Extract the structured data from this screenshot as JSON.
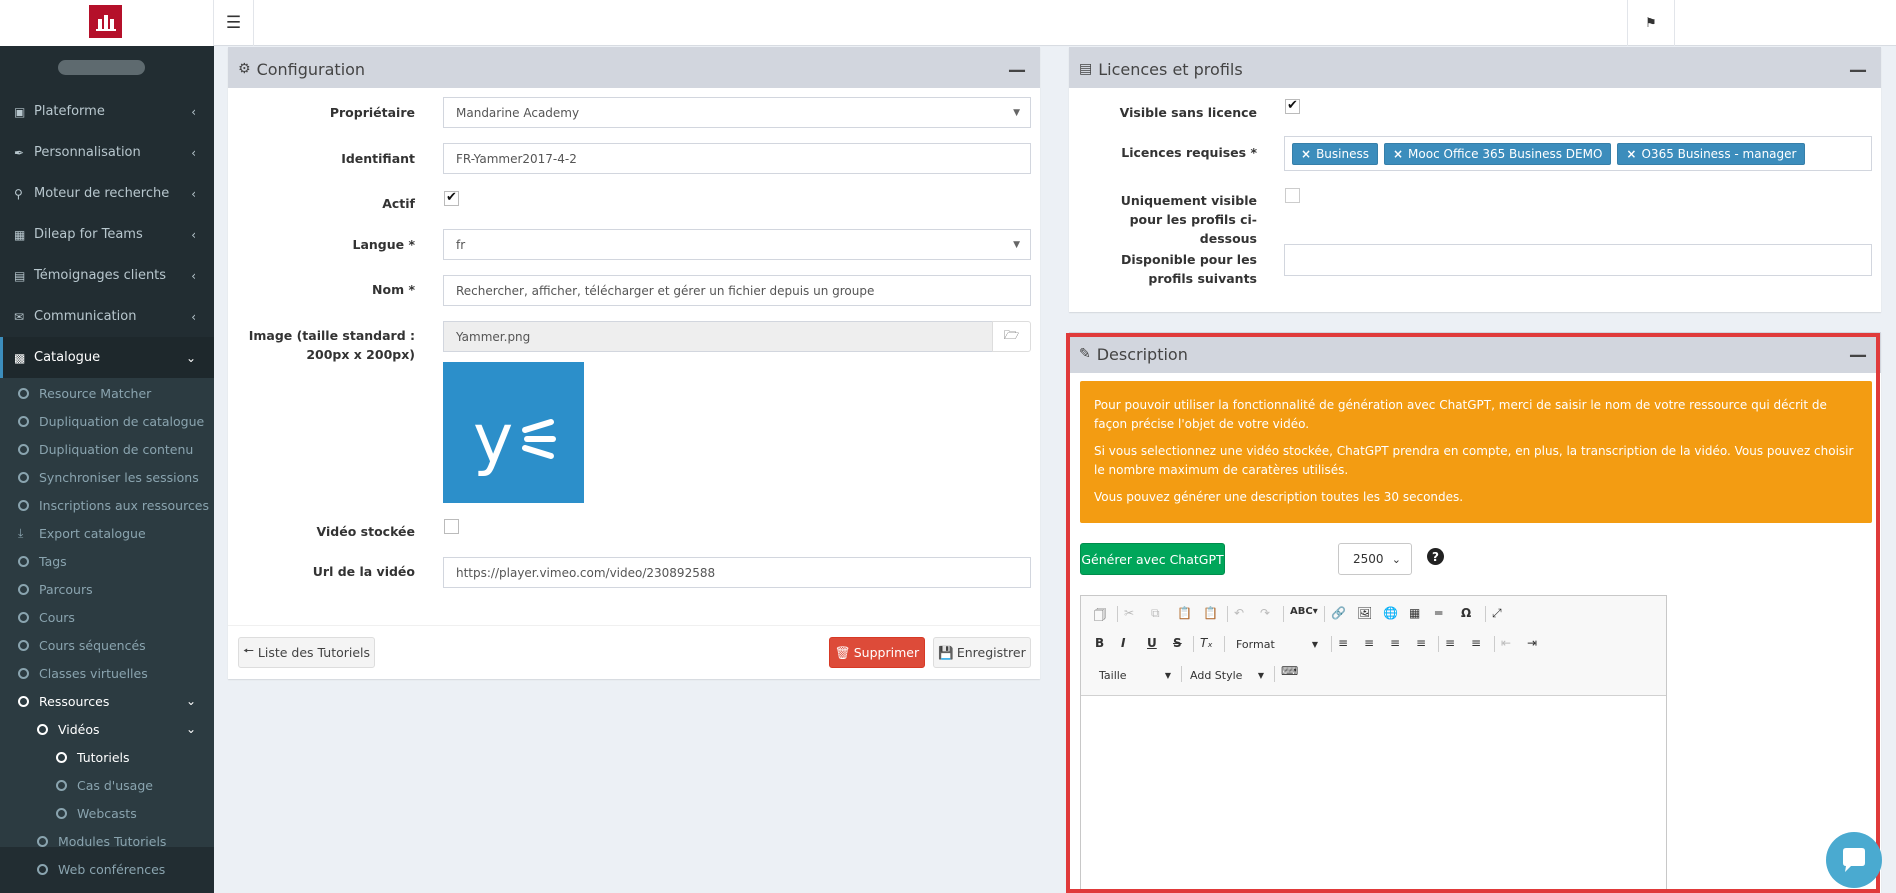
{
  "sidebar": {
    "items": [
      {
        "label": "Plateforme",
        "icon": "laptop-icon"
      },
      {
        "label": "Personnalisation",
        "icon": "brush-icon"
      },
      {
        "label": "Moteur de recherche",
        "icon": "search-icon"
      },
      {
        "label": "Dileap for Teams",
        "icon": "windows-icon"
      },
      {
        "label": "Témoignages clients",
        "icon": "id-card-icon"
      },
      {
        "label": "Communication",
        "icon": "envelope-open-icon"
      },
      {
        "label": "Catalogue",
        "icon": "book-icon"
      }
    ],
    "catalogue_sub": [
      "Resource Matcher",
      "Dupliquation de catalogue",
      "Dupliquation de contenu",
      "Synchroniser les sessions",
      "Inscriptions aux ressources",
      "Export catalogue",
      "Tags",
      "Parcours",
      "Cours",
      "Cours séquencés",
      "Classes virtuelles",
      "Ressources",
      "Vidéos",
      "Tutoriels",
      "Cas d'usage",
      "Webcasts",
      "Modules Tutoriels",
      "Web conférences"
    ]
  },
  "config": {
    "title": "Configuration",
    "proprietaire_label": "Propriétaire",
    "proprietaire_value": "Mandarine Academy",
    "identifiant_label": "Identifiant",
    "identifiant_value": "FR-Yammer2017-4-2",
    "actif_label": "Actif",
    "langue_label": "Langue *",
    "langue_value": "fr",
    "nom_label": "Nom *",
    "nom_value": "Rechercher, afficher, télécharger et gérer un fichier depuis un groupe",
    "image_label": "Image (taille standard : 200px x 200px)",
    "image_value": "Yammer.png",
    "video_stockee_label": "Vidéo stockée",
    "url_label": "Url de la vidéo",
    "url_value": "https://player.vimeo.com/video/230892588",
    "back_button": "Liste des Tutoriels",
    "delete_button": "Supprimer",
    "save_button": "Enregistrer"
  },
  "licences": {
    "title": "Licences et profils",
    "visible_label": "Visible sans licence",
    "requises_label": "Licences requises *",
    "tags": [
      "Business",
      "Mooc Office 365 Business DEMO",
      "O365 Business - manager"
    ],
    "uniquement_label": "Uniquement visible pour les profils ci-dessous",
    "disponible_label": "Disponible pour les profils suivants"
  },
  "description": {
    "title": "Description",
    "alert_p1": "Pour pouvoir utiliser la fonctionnalité de génération avec ChatGPT, merci de saisir le nom de votre ressource qui décrit de façon précise l'objet de votre vidéo.",
    "alert_p2": "Si vous selectionnez une vidéo stockée, ChatGPT prendra en compte, en plus, la transcription de la vidéo. Vous pouvez choisir le nombre maximum de caratères utilisés.",
    "alert_p3": "Vous pouvez générer une description toutes les 30 secondes.",
    "generate_button": "Générer avec ChatGPT",
    "max_chars": "2500",
    "format_label": "Format",
    "taille_label": "Taille",
    "addstyle_label": "Add Style"
  },
  "colors": {
    "sidebar_bg": "#222d32",
    "accent": "#3c8dbc",
    "alert": "#f39c12",
    "danger": "#dd4b39",
    "success": "#00a65a",
    "highlight": "#e03a3a",
    "brand": "#b5102a"
  }
}
